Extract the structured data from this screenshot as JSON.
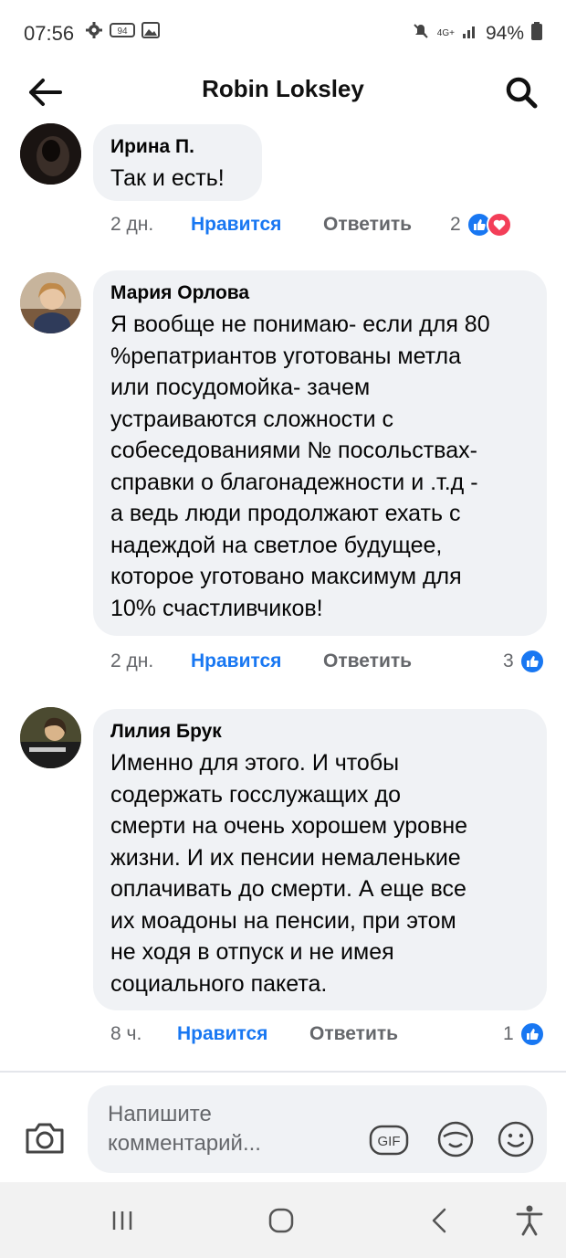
{
  "status_bar": {
    "time": "07:56",
    "left_icons": [
      "settings-gear-icon",
      "badge-94-icon",
      "image-icon"
    ],
    "badge_text": "94",
    "network": "4G+",
    "battery": "94%"
  },
  "header": {
    "title": "Robin Loksley",
    "back_icon": "arrow-left-icon",
    "search_icon": "search-icon"
  },
  "comments": [
    {
      "author": "Ирина П.",
      "text": "Так и есть!",
      "time": "2 дн.",
      "like_label": "Нравится",
      "reply_label": "Ответить",
      "reaction_count": "2",
      "reactions": [
        "like",
        "love"
      ]
    },
    {
      "author": "Мария Орлова",
      "text": "Я вообще не понимаю- если для 80\n%репатриантов уготованы метла\nили посудомойка- зачем\nустраиваются сложности с\nсобеседованиями № посольствах-\nсправки о благонадежности и .т.д -\nа ведь люди продолжают ехать с\nнадеждой на светлое будущее,\nкоторое уготовано максимум для\n10% счастливчиков!",
      "time": "2 дн.",
      "like_label": "Нравится",
      "reply_label": "Ответить",
      "reaction_count": "3",
      "reactions": [
        "like"
      ]
    },
    {
      "author": "Лилия Брук",
      "text": "Именно для этого. И чтобы\nсодержать госслужащих до\nсмерти на очень хорошем уровне\nжизни. И их пенсии немаленькие\nоплачивать до смерти. А еще все\nих моадоны на пенсии, при этом\nне ходя в отпуск и не имея\nсоциального пакета.",
      "time": "8 ч.",
      "like_label": "Нравится",
      "reply_label": "Ответить",
      "reaction_count": "1",
      "reactions": [
        "like"
      ]
    }
  ],
  "composer": {
    "placeholder": "Напишите комментарий...",
    "gif_label": "GIF",
    "camera_icon": "camera-icon",
    "sticker_icon": "sticker-icon",
    "emoji_icon": "emoji-icon"
  },
  "navbar": {
    "icons": [
      "recent-apps-icon",
      "home-icon",
      "back-icon",
      "accessibility-icon"
    ]
  },
  "colors": {
    "accent": "#1877f2",
    "love": "#f33e58",
    "bubble": "#f0f2f5",
    "secondary_text": "#65676b"
  }
}
